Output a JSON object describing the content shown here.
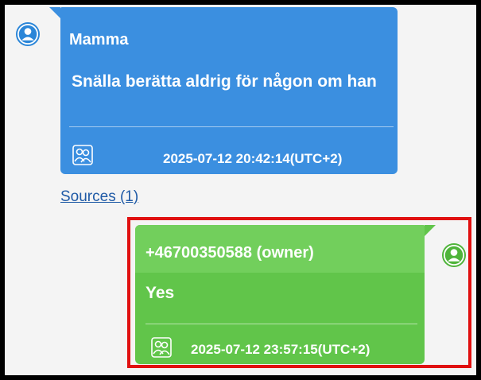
{
  "conversation": {
    "incoming": {
      "sender": "Mamma",
      "message": "Snälla berätta aldrig för någon om han",
      "timestamp": "2025-07-12 20:42:14(UTC+2)",
      "participants_icon": "group-icon",
      "avatar_icon": "person-icon",
      "color": "#3b8fe0"
    },
    "sources_link": "Sources (1)",
    "outgoing": {
      "sender": "+46700350588 (owner)",
      "message": "Yes",
      "timestamp": "2025-07-12 23:57:15(UTC+2)",
      "participants_icon": "group-icon",
      "avatar_icon": "person-icon",
      "color": "#61c54a",
      "highlighted": true,
      "highlight_color": "#e01010"
    }
  }
}
